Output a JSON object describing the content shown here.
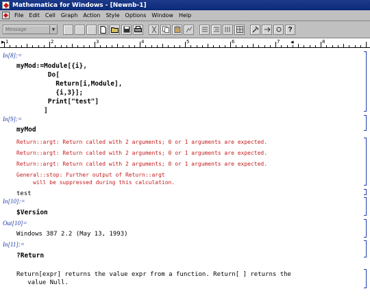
{
  "window": {
    "title": "Mathematica for Windows - [Newnb-1]"
  },
  "menu": [
    "File",
    "Edit",
    "Cell",
    "Graph",
    "Action",
    "Style",
    "Options",
    "Window",
    "Help"
  ],
  "toolbar": {
    "style_value": "Message",
    "buttons": [
      "empty-1",
      "empty-2",
      "empty-3",
      "new-icon",
      "open-icon",
      "save-icon",
      "print-icon",
      "cut-icon",
      "copy-icon",
      "paste-icon",
      "graph-icon",
      "align-icon",
      "list-icon",
      "lines-icon",
      "tools-icon",
      "run-icon",
      "help-icon"
    ]
  },
  "ruler": {
    "labels": [
      "1",
      "2",
      "3",
      "4",
      "5",
      "6",
      "7",
      "8"
    ]
  },
  "notebook": {
    "in8_label": "In[8]:=",
    "in8_lines": [
      "myMod:=Module[{i},",
      "        Do[",
      "          Return[i,Module],",
      "          {i,3}];",
      "        Print[\"test\"]",
      "       ]"
    ],
    "in9_label": "In[9]:=",
    "in9_input": "myMod",
    "messages": [
      "Return::argt: Return called with 2 arguments; 0 or 1 arguments are expected.",
      "Return::argt: Return called with 2 arguments; 0 or 1 arguments are expected.",
      "Return::argt: Return called with 2 arguments; 0 or 1 arguments are expected.",
      "General::stop: Further output of Return::argt",
      "     will be suppressed during this calculation."
    ],
    "print_output": "test",
    "in10_label": "In[10]:=",
    "in10_input": "$Version",
    "out10_label": "Out[10]=",
    "out10_value": "Windows 387 2.2 (May 13, 1993)",
    "in11_label": "In[11]:=",
    "in11_input": "?Return",
    "help_line1": "Return[expr] returns the value expr from a function. Return[ ] returns the",
    "help_line2": "   value Null."
  },
  "colors": {
    "label": "#1f3aa8",
    "message": "#c41a1a",
    "titlebar": "#0b2a7a"
  }
}
